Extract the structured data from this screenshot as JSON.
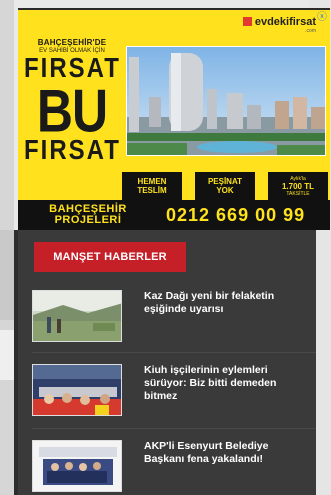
{
  "ad": {
    "close_symbol": "ⓧ",
    "brand": "evdekifirsat",
    "brand_sub": ".com",
    "headline_pre1": "BAHÇEŞEHİR'DE",
    "headline_pre2": "EV SAHİBİ OLMAK İÇİN",
    "headline_big1": "FIRSAT",
    "headline_big2": "BU",
    "headline_big3": "FIRSAT",
    "buttons": [
      {
        "line1": "HEMEN",
        "line2": "TESLİM",
        "small": ""
      },
      {
        "line1": "PEŞİNAT",
        "line2": "YOK",
        "small": ""
      },
      {
        "line1": "1.700 TL",
        "line2": "",
        "small_top": "Aylık'la",
        "small": "TAKSİTLE"
      }
    ],
    "projects_label_1": "BAHÇEŞEHİR",
    "projects_label_2": "PROJELERİ",
    "phone": "0212 669 00 99"
  },
  "news": {
    "tab_label": "MANŞET HABERLER",
    "items": [
      {
        "title": "Kaz Dağı yeni bir felaketin eşiğinde uyarısı"
      },
      {
        "title": "Kiuh işçilerinin eylemleri sürüyor: Biz bitti demeden bitmez"
      },
      {
        "title": "AKP'li Esenyurt Belediye Başkanı fena yakalandı!"
      }
    ]
  },
  "colors": {
    "ad_yellow": "#ffe21d",
    "tab_red": "#c51f28",
    "panel_dark": "#3a3a3a"
  }
}
